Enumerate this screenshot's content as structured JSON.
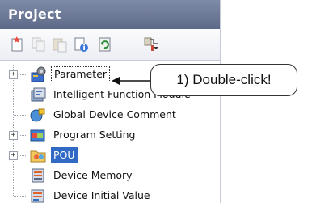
{
  "panel": {
    "title": "Project",
    "toolbar": [
      "new-project-icon",
      "copy-icon",
      "paste-icon",
      "properties-icon",
      "refresh-icon",
      "filter-icon"
    ]
  },
  "tree": {
    "items": [
      {
        "label": "Parameter",
        "icon": "parameter-icon",
        "expander": "+",
        "selected": false
      },
      {
        "label": "Intelligent Function Module",
        "icon": "intelligent-module-icon",
        "expander": "",
        "selected": false
      },
      {
        "label": "Global Device Comment",
        "icon": "device-comment-icon",
        "expander": "",
        "selected": false
      },
      {
        "label": "Program Setting",
        "icon": "program-setting-icon",
        "expander": "+",
        "selected": false
      },
      {
        "label": "POU",
        "icon": "pou-icon",
        "expander": "+",
        "selected": true
      },
      {
        "label": "Device Memory",
        "icon": "device-memory-icon",
        "expander": "",
        "selected": false
      },
      {
        "label": "Device Initial Value",
        "icon": "device-initial-value-icon",
        "expander": "",
        "selected": false
      }
    ]
  },
  "callout": {
    "text": "1) Double-click!"
  },
  "colors": {
    "titlebar": "#6b7795",
    "selection": "#316ac5"
  }
}
